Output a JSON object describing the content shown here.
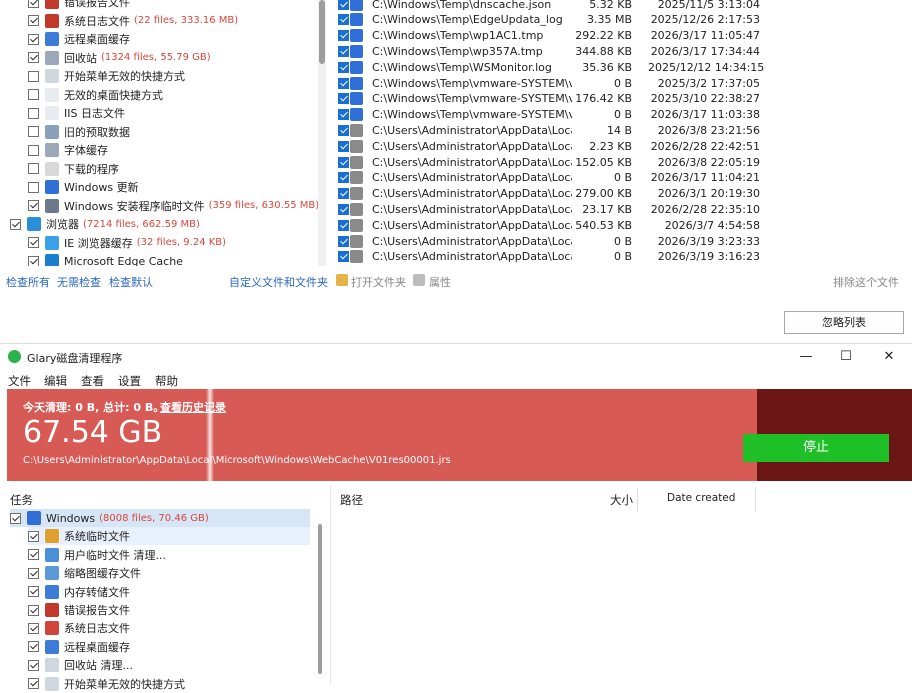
{
  "upper": {
    "tree": [
      {
        "label": "错误报告文件",
        "extra": ""
      },
      {
        "label": "系统日志文件",
        "extra": "(22 files, 333.16 MB)"
      },
      {
        "label": "远程桌面缓存",
        "extra": ""
      },
      {
        "label": "回收站",
        "extra": "(1324 files, 55.79 GB)"
      },
      {
        "label": "开始菜单无效的快捷方式",
        "extra": ""
      },
      {
        "label": "无效的桌面快捷方式",
        "extra": ""
      },
      {
        "label": "IIS 日志文件",
        "extra": ""
      },
      {
        "label": "旧的预取数据",
        "extra": ""
      },
      {
        "label": "字体缓存",
        "extra": ""
      },
      {
        "label": "下载的程序",
        "extra": ""
      },
      {
        "label": "Windows 更新",
        "extra": ""
      },
      {
        "label": "Windows 安装程序临时文件",
        "extra": "(359 files, 630.55 MB)"
      },
      {
        "label": "浏览器",
        "extra": "(7214 files, 662.59 MB)"
      },
      {
        "label": "IE 浏览器缓存",
        "extra": "(32 files, 9.24 KB)"
      },
      {
        "label": "Microsoft Edge Cache",
        "extra": ""
      }
    ],
    "files": [
      {
        "path": "C:\\Windows\\Temp\\dnscache.json",
        "size": "5.32 KB",
        "date": "2025/11/5 3:13:04"
      },
      {
        "path": "C:\\Windows\\Temp\\EdgeUpdata_log",
        "size": "3.35 MB",
        "date": "2025/12/26 2:17:53"
      },
      {
        "path": "C:\\Windows\\Temp\\wp1AC1.tmp",
        "size": "292.22 KB",
        "date": "2026/3/17 11:05:47"
      },
      {
        "path": "C:\\Windows\\Temp\\wp357A.tmp",
        "size": "344.88 KB",
        "date": "2026/3/17 17:34:44"
      },
      {
        "path": "C:\\Windows\\Temp\\WSMonitor.log",
        "size": "35.36 KB",
        "date": "2025/12/12 14:34:15"
      },
      {
        "path": "C:\\Windows\\Temp\\vmware-SYSTEM\\vma...",
        "size": "0 B",
        "date": "2025/3/2 17:37:05"
      },
      {
        "path": "C:\\Windows\\Temp\\vmware-SYSTEM\\vmw...",
        "size": "176.42 KB",
        "date": "2025/3/10 22:38:27"
      },
      {
        "path": "C:\\Windows\\Temp\\vmware-SYSTEM\\vmw...",
        "size": "0 B",
        "date": "2026/3/17 11:03:38"
      },
      {
        "path": "C:\\Users\\Administrator\\AppData\\Local\\T...",
        "size": "14 B",
        "date": "2026/3/8 23:21:56"
      },
      {
        "path": "C:\\Users\\Administrator\\AppData\\Local\\T...",
        "size": "2.23 KB",
        "date": "2026/2/28 22:42:51"
      },
      {
        "path": "C:\\Users\\Administrator\\AppData\\Local\\T...",
        "size": "152.05 KB",
        "date": "2026/3/8 22:05:19"
      },
      {
        "path": "C:\\Users\\Administrator\\AppData\\Local\\T...",
        "size": "0 B",
        "date": "2026/3/17 11:04:21"
      },
      {
        "path": "C:\\Users\\Administrator\\AppData\\Local\\T...",
        "size": "279.00 KB",
        "date": "2026/3/1 20:19:30"
      },
      {
        "path": "C:\\Users\\Administrator\\AppData\\Local\\T...",
        "size": "23.17 KB",
        "date": "2026/2/28 22:35:10"
      },
      {
        "path": "C:\\Users\\Administrator\\AppData\\Local\\T...",
        "size": "540.53 KB",
        "date": "2026/3/7 4:54:58"
      },
      {
        "path": "C:\\Users\\Administrator\\AppData\\Local\\T...",
        "size": "0 B",
        "date": "2026/3/19 3:23:33"
      },
      {
        "path": "C:\\Users\\Administrator\\AppData\\Local\\T...",
        "size": "0 B",
        "date": "2026/3/19 3:16:23"
      }
    ],
    "links": {
      "check_all": "检查所有",
      "no_check": "无需检查",
      "check_default": "检查默认",
      "custom": "自定义文件和文件夹",
      "open_folder": "打开文件夹",
      "properties": "属性",
      "exclude": "排除这个文件"
    },
    "ignore_button": "忽略列表"
  },
  "window": {
    "title": "Glary磁盘清理程序",
    "minimize": "—",
    "maximize": "☐",
    "close": "✕"
  },
  "menu": [
    "文件",
    "编辑",
    "查看",
    "设置",
    "帮助"
  ],
  "banner": {
    "today": "今天清理: 0 B, 总计: 0 B。",
    "history": "查看历史记录",
    "amount": "67.54 GB",
    "current_path": "C:\\Users\\Administrator\\AppData\\Local\\Microsoft\\Windows\\WebCache\\V01res00001.jrs",
    "stop": "停止",
    "color_red": "#d85a55",
    "color_dark": "#6b1515",
    "color_green": "#1fbf28"
  },
  "lower": {
    "tasks_header": "任务",
    "columns": {
      "path": "路径",
      "size": "大小",
      "date": "Date created"
    },
    "tree": [
      {
        "label": "Windows",
        "extra": "(8008 files, 70.46 GB)"
      },
      {
        "label": "系统临时文件",
        "extra": ""
      },
      {
        "label": "用户临时文件  清理...",
        "extra": ""
      },
      {
        "label": "缩略图缓存文件",
        "extra": ""
      },
      {
        "label": "内存转储文件",
        "extra": ""
      },
      {
        "label": "错误报告文件",
        "extra": ""
      },
      {
        "label": "系统日志文件",
        "extra": ""
      },
      {
        "label": "远程桌面缓存",
        "extra": ""
      },
      {
        "label": "回收站  清理...",
        "extra": ""
      },
      {
        "label": "开始菜单无效的快捷方式",
        "extra": ""
      }
    ]
  }
}
